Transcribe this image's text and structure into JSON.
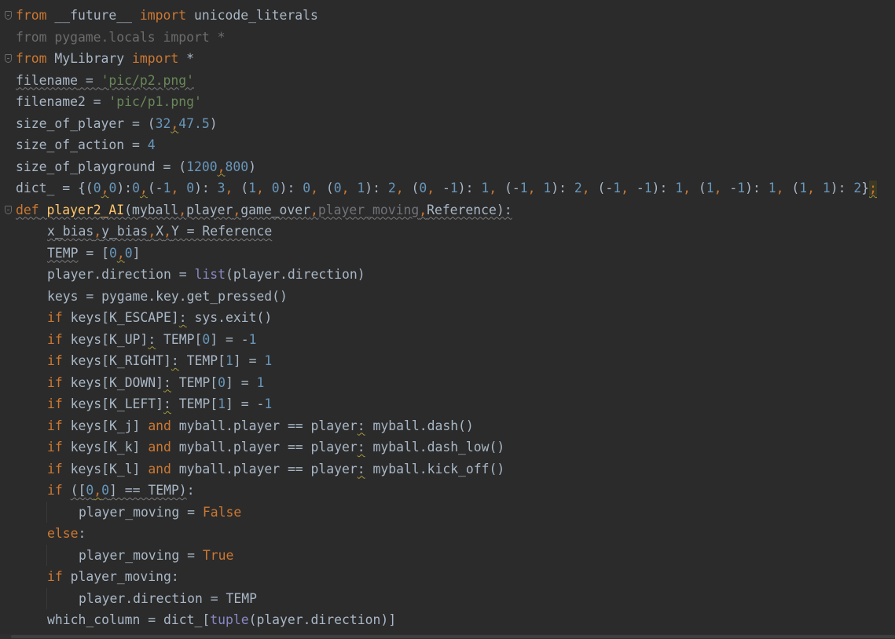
{
  "editor": {
    "language": "Python",
    "colors": {
      "background": "#2b2b2b",
      "default": "#a9b7c6",
      "keyword": "#cc7832",
      "string": "#6a8759",
      "number": "#6897bb",
      "builtin": "#8888c6",
      "function": "#ffc66d",
      "unused": "#6c6c6c"
    },
    "lines": [
      [
        {
          "t": "from",
          "c": "kw"
        },
        {
          "t": " __future__ "
        },
        {
          "t": "import",
          "c": "kw"
        },
        {
          "t": " unicode_literals"
        }
      ],
      [
        {
          "t": "from pygame.locals import *",
          "c": "unused"
        }
      ],
      [
        {
          "t": "from",
          "c": "kw"
        },
        {
          "t": " MyLibrary "
        },
        {
          "t": "import",
          "c": "kw"
        },
        {
          "t": " *"
        }
      ],
      [
        {
          "t": "filename",
          "c": "weak"
        },
        {
          "t": " = ",
          "c": "weak"
        },
        {
          "t": "'pic/p2.png'",
          "c": "str weak"
        }
      ],
      [
        {
          "t": "filename2 = "
        },
        {
          "t": "'pic/p1.png'",
          "c": "str"
        }
      ],
      [
        {
          "t": "size_of_player = ("
        },
        {
          "t": "32",
          "c": "num"
        },
        {
          "t": ",",
          "c": "kw warn"
        },
        {
          "t": "47.5",
          "c": "num"
        },
        {
          "t": ")"
        }
      ],
      [
        {
          "t": "size_of_action = "
        },
        {
          "t": "4",
          "c": "num"
        }
      ],
      [
        {
          "t": "size_of_playground = ("
        },
        {
          "t": "1200",
          "c": "num"
        },
        {
          "t": ",",
          "c": "kw warn"
        },
        {
          "t": "800",
          "c": "num"
        },
        {
          "t": ")"
        }
      ],
      [
        {
          "t": "dict_ = {("
        },
        {
          "t": "0",
          "c": "num"
        },
        {
          "t": ",",
          "c": "kw warn"
        },
        {
          "t": "0",
          "c": "num"
        },
        {
          "t": "):"
        },
        {
          "t": "0",
          "c": "num"
        },
        {
          "t": ",",
          "c": "kw warn"
        },
        {
          "t": "(-"
        },
        {
          "t": "1",
          "c": "num"
        },
        {
          "t": ", ",
          "c": "kw"
        },
        {
          "t": "0",
          "c": "num"
        },
        {
          "t": "): "
        },
        {
          "t": "3",
          "c": "num"
        },
        {
          "t": ", ",
          "c": "kw"
        },
        {
          "t": "("
        },
        {
          "t": "1",
          "c": "num"
        },
        {
          "t": ", ",
          "c": "kw"
        },
        {
          "t": "0",
          "c": "num"
        },
        {
          "t": "): "
        },
        {
          "t": "0",
          "c": "num"
        },
        {
          "t": ", ",
          "c": "kw"
        },
        {
          "t": "("
        },
        {
          "t": "0",
          "c": "num"
        },
        {
          "t": ", ",
          "c": "kw"
        },
        {
          "t": "1",
          "c": "num"
        },
        {
          "t": "): "
        },
        {
          "t": "2",
          "c": "num"
        },
        {
          "t": ", ",
          "c": "kw"
        },
        {
          "t": "("
        },
        {
          "t": "0",
          "c": "num"
        },
        {
          "t": ", ",
          "c": "kw"
        },
        {
          "t": "-"
        },
        {
          "t": "1",
          "c": "num"
        },
        {
          "t": "): "
        },
        {
          "t": "1",
          "c": "num"
        },
        {
          "t": ", ",
          "c": "kw"
        },
        {
          "t": "(-"
        },
        {
          "t": "1",
          "c": "num"
        },
        {
          "t": ", ",
          "c": "kw"
        },
        {
          "t": "1",
          "c": "num"
        },
        {
          "t": "): "
        },
        {
          "t": "2",
          "c": "num"
        },
        {
          "t": ", ",
          "c": "kw"
        },
        {
          "t": "(-"
        },
        {
          "t": "1",
          "c": "num"
        },
        {
          "t": ", ",
          "c": "kw"
        },
        {
          "t": "-"
        },
        {
          "t": "1",
          "c": "num"
        },
        {
          "t": "): "
        },
        {
          "t": "1",
          "c": "num"
        },
        {
          "t": ", ",
          "c": "kw"
        },
        {
          "t": "("
        },
        {
          "t": "1",
          "c": "num"
        },
        {
          "t": ", ",
          "c": "kw"
        },
        {
          "t": "-"
        },
        {
          "t": "1",
          "c": "num"
        },
        {
          "t": "): "
        },
        {
          "t": "1",
          "c": "num"
        },
        {
          "t": ", ",
          "c": "kw"
        },
        {
          "t": "("
        },
        {
          "t": "1",
          "c": "num"
        },
        {
          "t": ", ",
          "c": "kw"
        },
        {
          "t": "1",
          "c": "num"
        },
        {
          "t": "): "
        },
        {
          "t": "2",
          "c": "num"
        },
        {
          "t": "}"
        },
        {
          "t": ";",
          "c": "kw warn caret-hl"
        }
      ],
      [
        {
          "t": "def",
          "c": "kw weak"
        },
        {
          "t": " ",
          "c": "weak"
        },
        {
          "t": "player2_AI",
          "c": "fn weak"
        },
        {
          "t": "(myball",
          "c": "weak"
        },
        {
          "t": ",",
          "c": "kw weak"
        },
        {
          "t": "player",
          "c": "weak"
        },
        {
          "t": ",",
          "c": "kw weak"
        },
        {
          "t": "game_over",
          "c": "weak"
        },
        {
          "t": ",",
          "c": "kw weak"
        },
        {
          "t": "player_moving",
          "c": "param-unused weak"
        },
        {
          "t": ",",
          "c": "kw weak"
        },
        {
          "t": "Reference):",
          "c": "weak"
        }
      ],
      [
        {
          "t": "x_bias",
          "c": "weak"
        },
        {
          "t": ",",
          "c": "kw weak"
        },
        {
          "t": "y_bias",
          "c": "weak"
        },
        {
          "t": ",",
          "c": "kw weak"
        },
        {
          "t": "X",
          "c": "weak"
        },
        {
          "t": ",",
          "c": "kw weak"
        },
        {
          "t": "Y = Reference",
          "c": "weak"
        }
      ],
      [
        {
          "t": "TEMP",
          "c": "weak"
        },
        {
          "t": " = ["
        },
        {
          "t": "0",
          "c": "num"
        },
        {
          "t": ",",
          "c": "kw warn"
        },
        {
          "t": "0",
          "c": "num"
        },
        {
          "t": "]"
        }
      ],
      [
        {
          "t": "player.direction = "
        },
        {
          "t": "list",
          "c": "builtin"
        },
        {
          "t": "(player.direction)"
        }
      ],
      [
        {
          "t": "keys = pygame.key.get_pressed()"
        }
      ],
      [
        {
          "t": "if",
          "c": "kw"
        },
        {
          "t": " keys[K_ESCAPE]"
        },
        {
          "t": ":",
          "c": "warn"
        },
        {
          "t": " sys.exit()"
        }
      ],
      [
        {
          "t": "if",
          "c": "kw"
        },
        {
          "t": " keys[K_UP]"
        },
        {
          "t": ":",
          "c": "warn"
        },
        {
          "t": " TEMP["
        },
        {
          "t": "0",
          "c": "num"
        },
        {
          "t": "] = -"
        },
        {
          "t": "1",
          "c": "num"
        }
      ],
      [
        {
          "t": "if",
          "c": "kw"
        },
        {
          "t": " keys[K_RIGHT]"
        },
        {
          "t": ":",
          "c": "warn"
        },
        {
          "t": " TEMP["
        },
        {
          "t": "1",
          "c": "num"
        },
        {
          "t": "] = "
        },
        {
          "t": "1",
          "c": "num"
        }
      ],
      [
        {
          "t": "if",
          "c": "kw"
        },
        {
          "t": " keys[K_DOWN]"
        },
        {
          "t": ":",
          "c": "warn"
        },
        {
          "t": " TEMP["
        },
        {
          "t": "0",
          "c": "num"
        },
        {
          "t": "] = "
        },
        {
          "t": "1",
          "c": "num"
        }
      ],
      [
        {
          "t": "if",
          "c": "kw"
        },
        {
          "t": " keys[K_LEFT]"
        },
        {
          "t": ":",
          "c": "warn"
        },
        {
          "t": " TEMP["
        },
        {
          "t": "1",
          "c": "num"
        },
        {
          "t": "] = -"
        },
        {
          "t": "1",
          "c": "num"
        }
      ],
      [
        {
          "t": "if",
          "c": "kw"
        },
        {
          "t": " keys[K_j] "
        },
        {
          "t": "and",
          "c": "kw"
        },
        {
          "t": " myball.player == player"
        },
        {
          "t": ":",
          "c": "warn"
        },
        {
          "t": " myball.dash()"
        }
      ],
      [
        {
          "t": "if",
          "c": "kw"
        },
        {
          "t": " keys[K_k] "
        },
        {
          "t": "and",
          "c": "kw"
        },
        {
          "t": " myball.player == player"
        },
        {
          "t": ":",
          "c": "warn"
        },
        {
          "t": " myball.dash_low()"
        }
      ],
      [
        {
          "t": "if",
          "c": "kw"
        },
        {
          "t": " keys[K_l] "
        },
        {
          "t": "and",
          "c": "kw"
        },
        {
          "t": " myball.player == player"
        },
        {
          "t": ":",
          "c": "warn"
        },
        {
          "t": " myball.kick_off()"
        }
      ],
      [
        {
          "t": "if",
          "c": "kw"
        },
        {
          "t": " "
        },
        {
          "t": "([",
          "c": "weak"
        },
        {
          "t": "0",
          "c": "num weak"
        },
        {
          "t": ",",
          "c": "kw warn"
        },
        {
          "t": "0",
          "c": "num weak"
        },
        {
          "t": "] == TEMP)",
          "c": "weak"
        },
        {
          "t": ":"
        }
      ],
      [
        {
          "t": "player_moving = "
        },
        {
          "t": "False",
          "c": "kw"
        }
      ],
      [
        {
          "t": "else",
          "c": "kw"
        },
        {
          "t": ":"
        }
      ],
      [
        {
          "t": "player_moving = "
        },
        {
          "t": "True",
          "c": "kw"
        }
      ],
      [
        {
          "t": "if",
          "c": "kw"
        },
        {
          "t": " player_moving:"
        }
      ],
      [
        {
          "t": "player.direction = TEMP"
        }
      ],
      [
        {
          "t": "which_column = dict_["
        },
        {
          "t": "tuple",
          "c": "builtin"
        },
        {
          "t": "(player.direction)]"
        }
      ]
    ],
    "indents": [
      0,
      0,
      0,
      0,
      0,
      0,
      0,
      0,
      0,
      0,
      1,
      1,
      1,
      1,
      1,
      1,
      1,
      1,
      1,
      1,
      1,
      1,
      1,
      2,
      1,
      2,
      1,
      2,
      1
    ],
    "folds": [
      0,
      2,
      9
    ]
  }
}
